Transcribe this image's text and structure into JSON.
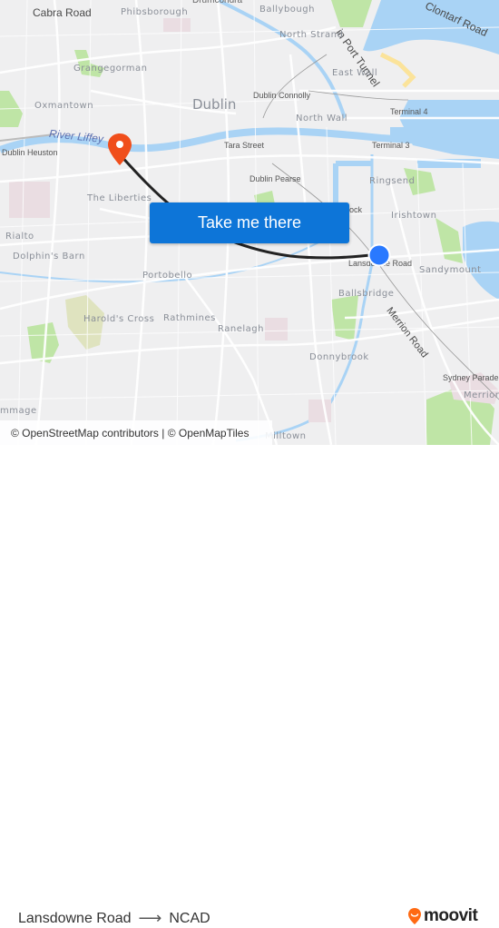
{
  "map": {
    "labels": {
      "cabra_road": "Cabra Road",
      "phibsborough": "Phibsborough",
      "drumcondra": "Drumcondra",
      "ballybough": "Ballybough",
      "port_tunnel": "in Port Tunnel",
      "clontarf_road": "Clontarf Road",
      "north_strand": "North Strand",
      "grangegorman": "Grangegorman",
      "east_wall": "East Wall",
      "oxmantown": "Oxmantown",
      "dublin": "Dublin",
      "dublin_connolly": "Dublin Connolly",
      "north_wall": "North Wall",
      "terminal_4": "Terminal 4",
      "river_liffey": "River Liffey",
      "dublin_heuston": "Dublin Heuston",
      "tara_street": "Tara Street",
      "terminal_3": "Terminal 3",
      "dublin_pearse": "Dublin Pearse",
      "ringsend": "Ringsend",
      "the_liberties": "The Liberties",
      "grand_canal_dock": "ock",
      "irishtown": "Irishtown",
      "rialto": "Rialto",
      "lansdowne_road": "Lansdowne Road",
      "sandymount": "Sandymount",
      "dolphins_barn": "Dolphin's Barn",
      "portobello": "Portobello",
      "ballsbridge": "Ballsbridge",
      "harolds_cross": "Harold's Cross",
      "rathmines": "Rathmines",
      "ranelagh": "Ranelagh",
      "merrion_road": "Merrion Road",
      "donnybrook": "Donnybrook",
      "sydney_parade": "Sydney Parade",
      "merrion": "Merrion",
      "kimmage": "mmage",
      "milltown": "Milltown"
    },
    "origin": {
      "name": "Lansdowne Road",
      "color": "#2979ff"
    },
    "destination": {
      "name": "NCAD",
      "color": "#f04e1b"
    },
    "route_color": "#222222",
    "cta_label": "Take me there",
    "cta_color": "#0d75d8",
    "attribution": "© OpenStreetMap contributors | © OpenMapTiles"
  },
  "footer": {
    "from": "Lansdowne Road",
    "arrow": "⟶",
    "to": "NCAD",
    "brand": "moovit",
    "brand_color": "#ff6a13"
  }
}
